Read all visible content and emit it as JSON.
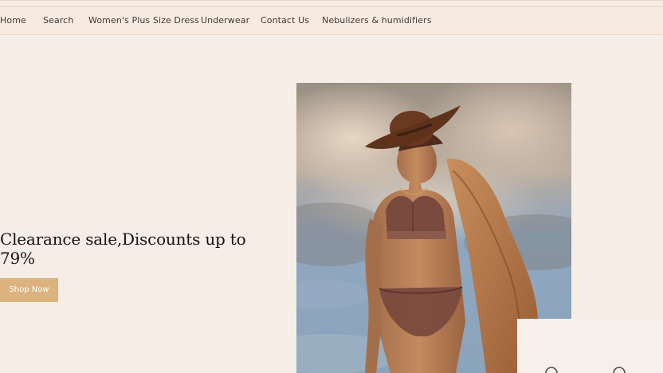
{
  "nav": {
    "items": [
      {
        "label": "Home"
      },
      {
        "label": "Search"
      },
      {
        "label": "Women's Plus Size Dress"
      },
      {
        "label": "Underwear"
      },
      {
        "label": "Contact Us"
      },
      {
        "label": "Nebulizers & humidifiers"
      }
    ]
  },
  "hero": {
    "title": "Clearance sale,Discounts up to 79%",
    "button_label": "Shop Now",
    "image": "model-in-hat-and-lace-lingerie-photo"
  },
  "colors": {
    "background": "#f5ede6",
    "nav_background": "#f7eae0",
    "button": "#dcb37e",
    "text": "#141414"
  }
}
